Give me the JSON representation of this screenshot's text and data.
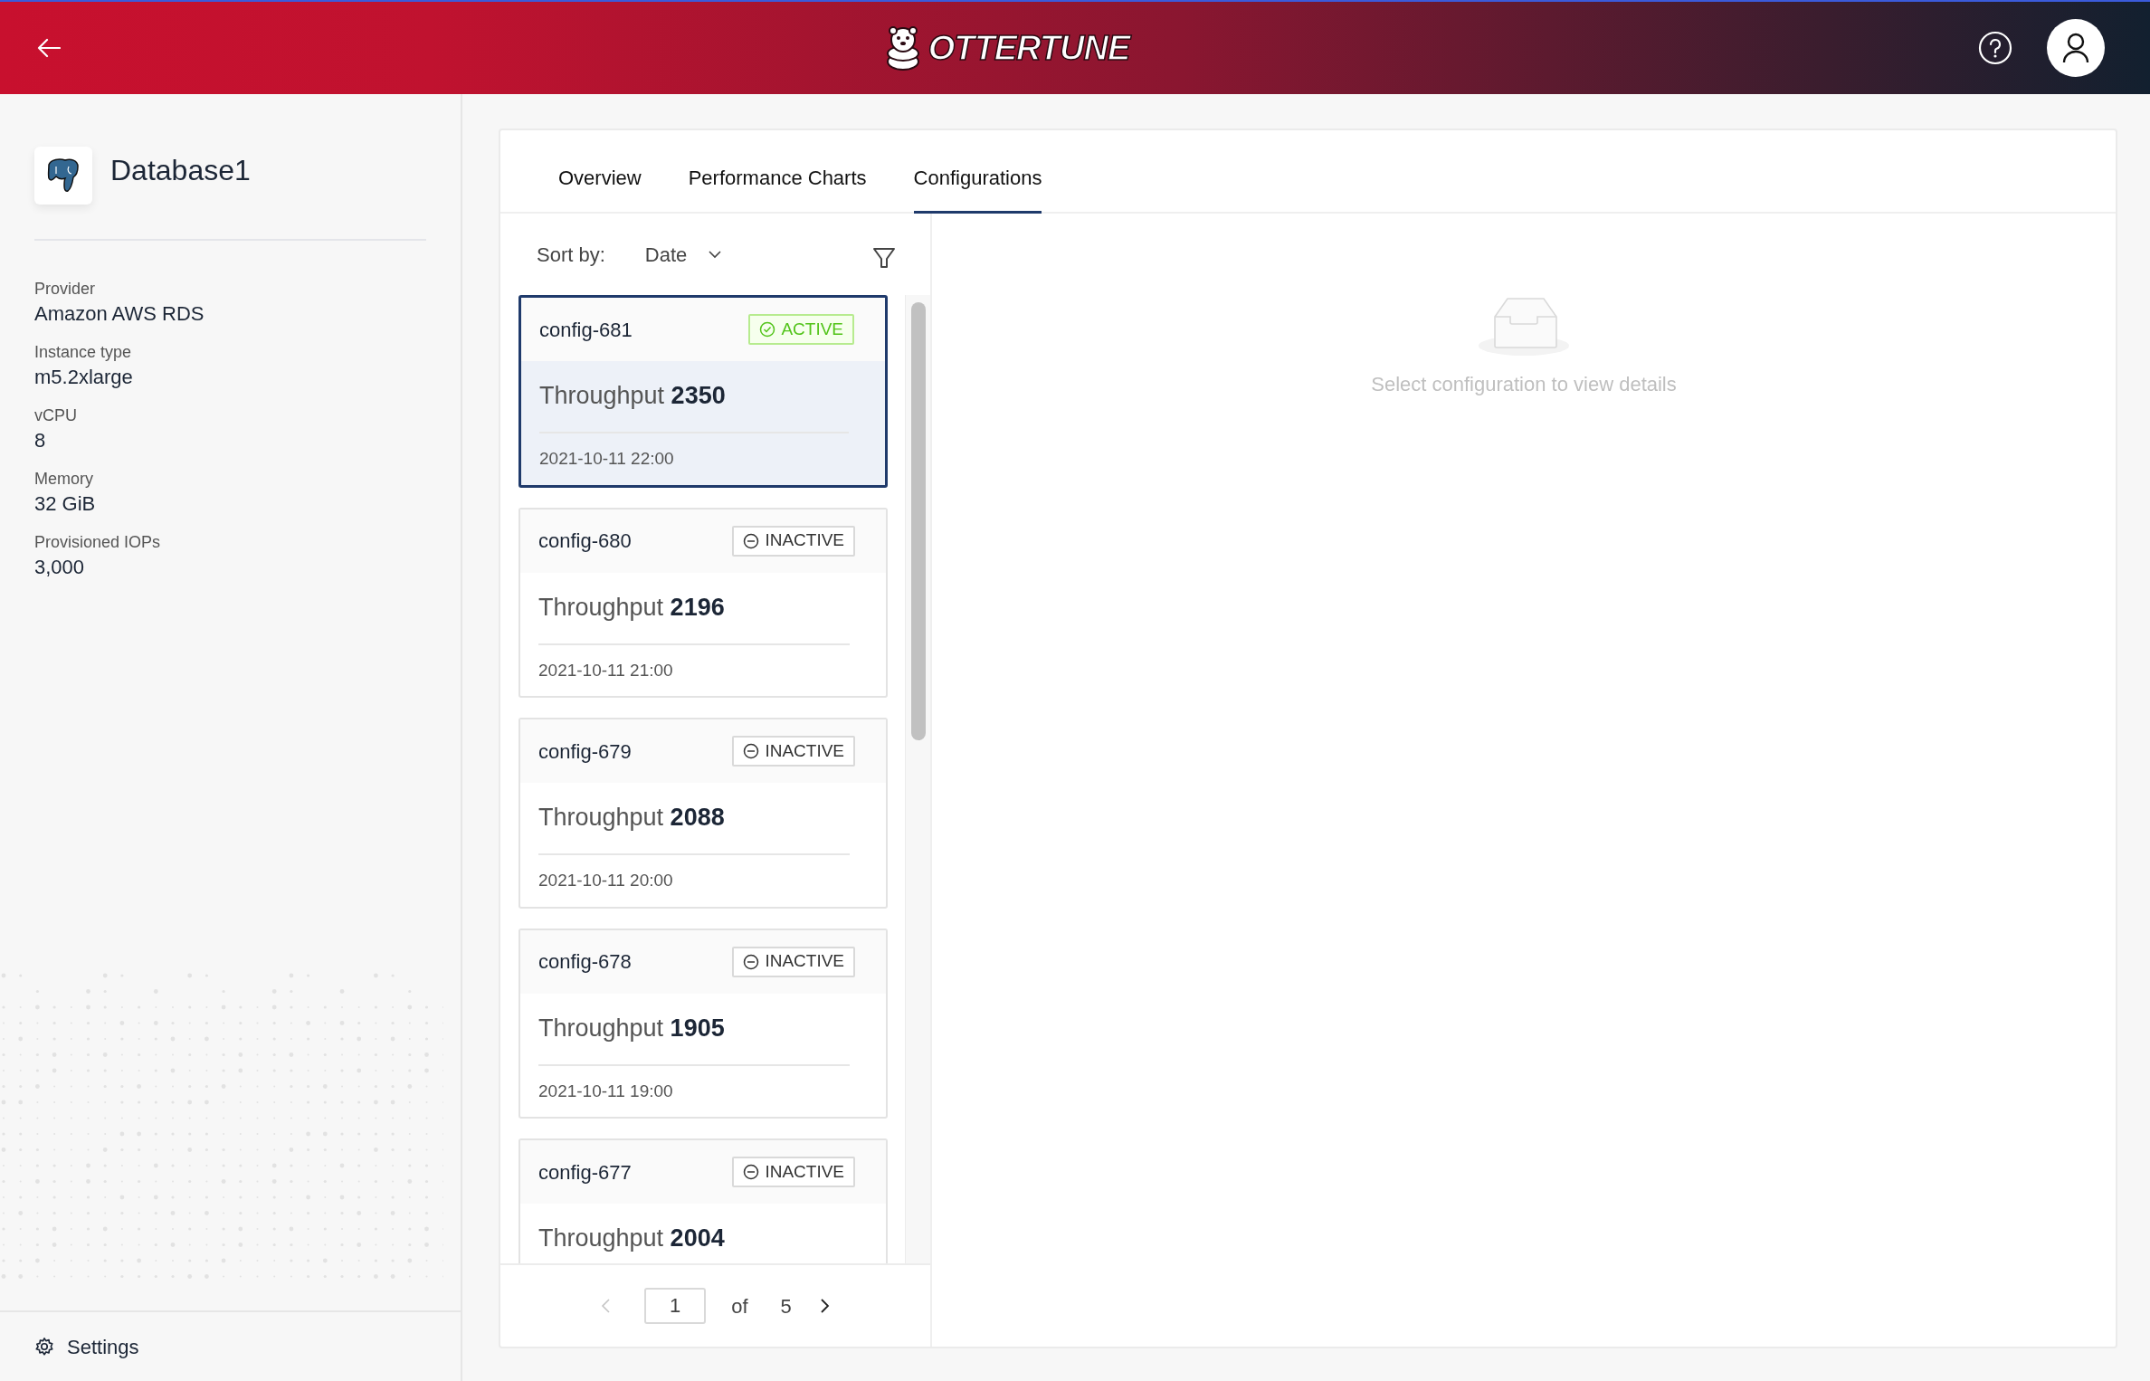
{
  "header": {
    "logo_text": "OTTERTUNE"
  },
  "database": {
    "name": "Database1",
    "details": [
      {
        "label": "Provider",
        "value": "Amazon AWS RDS"
      },
      {
        "label": "Instance type",
        "value": "m5.2xlarge"
      },
      {
        "label": "vCPU",
        "value": "8"
      },
      {
        "label": "Memory",
        "value": "32 GiB"
      },
      {
        "label": "Provisioned IOPs",
        "value": "3,000"
      }
    ]
  },
  "sidebar_footer": {
    "label": "Settings"
  },
  "tabs": [
    {
      "label": "Overview",
      "selected": false
    },
    {
      "label": "Performance Charts",
      "selected": false
    },
    {
      "label": "Configurations",
      "selected": true
    }
  ],
  "sort": {
    "label": "Sort by:",
    "value": "Date"
  },
  "configs": [
    {
      "name": "config-681",
      "kind": "active",
      "status_label": "ACTIVE",
      "throughput_label": "Throughput",
      "throughput": "2350",
      "date": "2021-10-11 22:00",
      "selected": true
    },
    {
      "name": "config-680",
      "kind": "inactive",
      "status_label": "INACTIVE",
      "throughput_label": "Throughput",
      "throughput": "2196",
      "date": "2021-10-11 21:00",
      "selected": false
    },
    {
      "name": "config-679",
      "kind": "inactive",
      "status_label": "INACTIVE",
      "throughput_label": "Throughput",
      "throughput": "2088",
      "date": "2021-10-11 20:00",
      "selected": false
    },
    {
      "name": "config-678",
      "kind": "inactive",
      "status_label": "INACTIVE",
      "throughput_label": "Throughput",
      "throughput": "1905",
      "date": "2021-10-11 19:00",
      "selected": false
    },
    {
      "name": "config-677",
      "kind": "inactive",
      "status_label": "INACTIVE",
      "throughput_label": "Throughput",
      "throughput": "2004",
      "selected": false
    }
  ],
  "pagination": {
    "page": "1",
    "of_label": "of",
    "total": "5"
  },
  "empty_state": {
    "message": "Select configuration to view details"
  }
}
